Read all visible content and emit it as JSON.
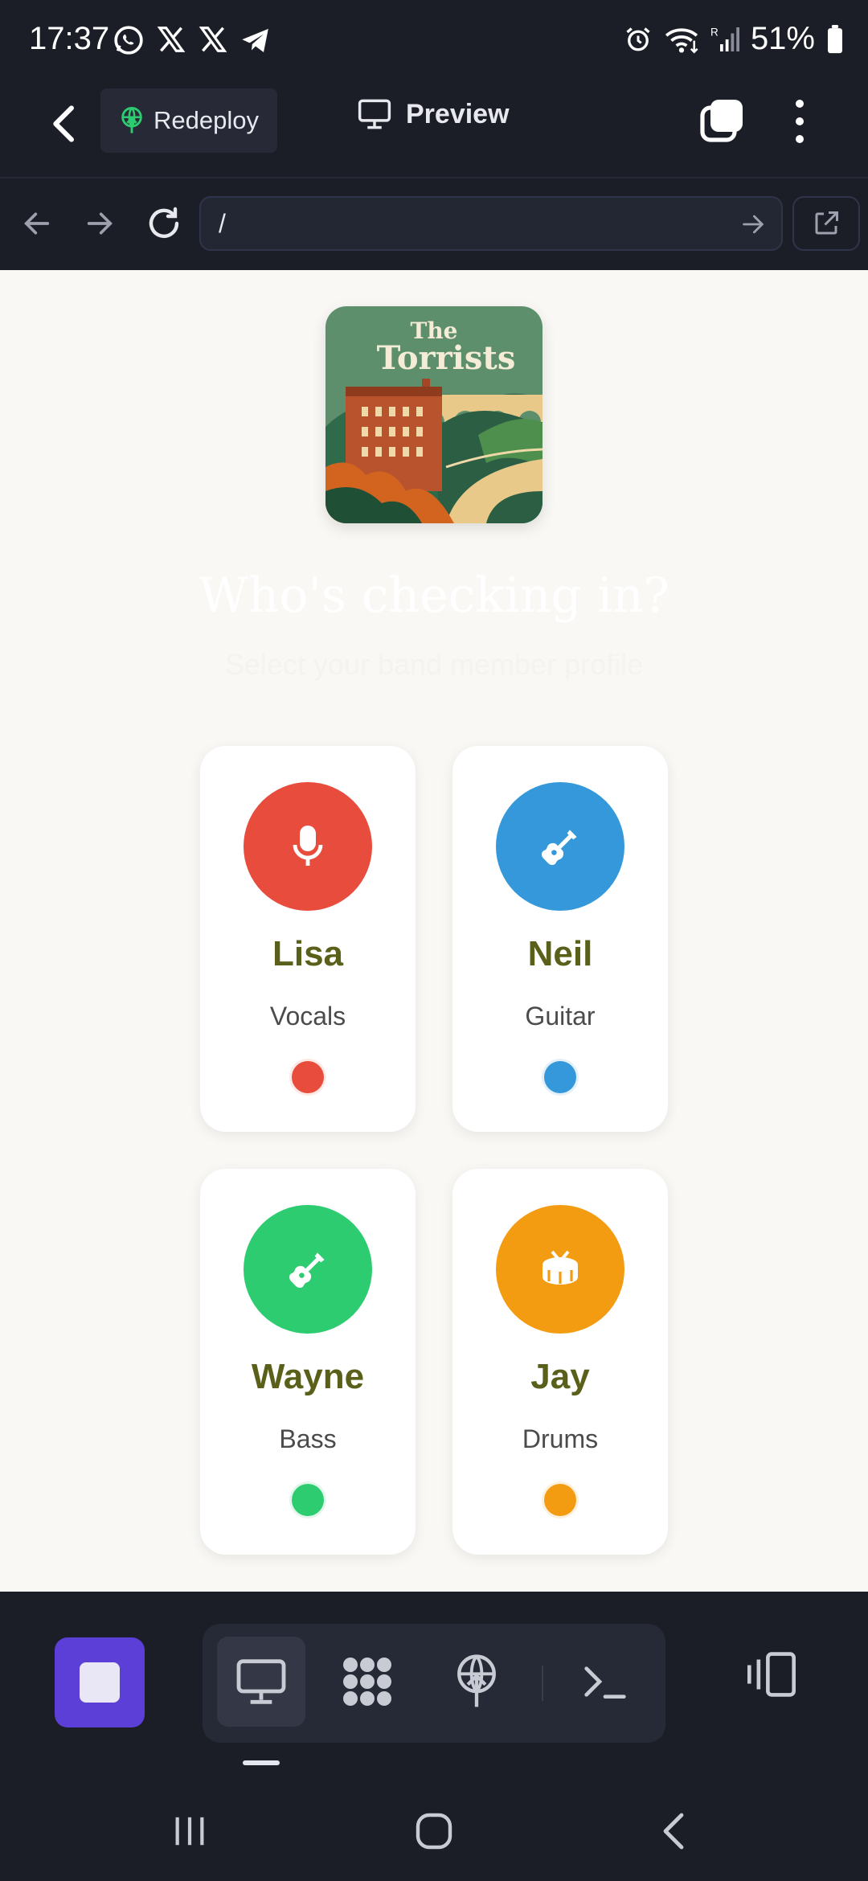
{
  "status_bar": {
    "time": "17:37",
    "app_icons": [
      "whatsapp-icon",
      "x-icon",
      "x-icon",
      "telegram-icon"
    ],
    "system_icons": [
      "alarm-icon",
      "wifi-icon",
      "signal-icon",
      "battery-icon"
    ],
    "battery": "51%"
  },
  "toolbar": {
    "back_icon": "chevron-left-icon",
    "redeploy_label": "Redeploy",
    "preview_label": "Preview"
  },
  "url_bar": {
    "path": "/"
  },
  "page": {
    "album_title_line1": "The",
    "album_title_line2": "Torrists",
    "heading": "Who's checking in?",
    "subheading": "Select your band member profile",
    "members": [
      {
        "name": "Lisa",
        "role": "Vocals",
        "color": "#e74c3c",
        "icon": "microphone-icon"
      },
      {
        "name": "Neil",
        "role": "Guitar",
        "color": "#3498db",
        "icon": "guitar-icon"
      },
      {
        "name": "Wayne",
        "role": "Bass",
        "color": "#2ecc71",
        "icon": "guitar-icon"
      },
      {
        "name": "Jay",
        "role": "Drums",
        "color": "#f39c12",
        "icon": "drum-icon"
      }
    ]
  },
  "bottom_bar": {
    "items": [
      "preview-icon",
      "apps-icon",
      "deploy-icon",
      "terminal-icon"
    ],
    "accent": "#5b3fd6"
  }
}
